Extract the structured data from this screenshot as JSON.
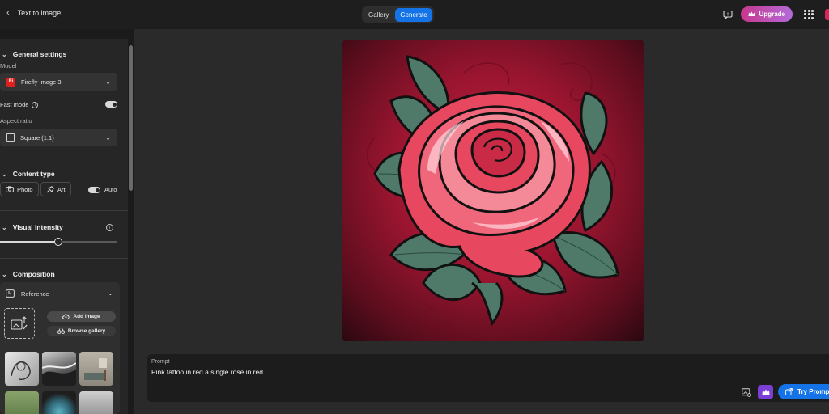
{
  "header": {
    "back_label": "Text to image",
    "tabs": [
      {
        "label": "Gallery",
        "active": false
      },
      {
        "label": "Generate",
        "active": true
      }
    ],
    "upgrade_label": "Upgrade"
  },
  "sidebar": {
    "general": {
      "title": "General settings",
      "model_label": "Model",
      "model_value": "Firefly Image 3",
      "model_icon_text": "Fi",
      "fast_mode_label": "Fast mode",
      "fast_mode_on": true,
      "aspect_label": "Aspect ratio",
      "aspect_value": "Square (1:1)"
    },
    "content_type": {
      "title": "Content type",
      "photo_label": "Photo",
      "art_label": "Art",
      "auto_label": "Auto",
      "auto_on": true
    },
    "visual_intensity": {
      "title": "Visual intensity",
      "level_fraction": 0.5
    },
    "composition": {
      "title": "Composition",
      "reference_label": "Reference",
      "add_image_label": "Add image",
      "browse_gallery_label": "Browse gallery"
    }
  },
  "prompt": {
    "label": "Prompt",
    "text": "Pink tattoo in red a single rose in red",
    "try_label": "Try Prompt"
  },
  "colors": {
    "accent": "#1473e6",
    "upgrade_gradient_start": "#c7378c",
    "upgrade_gradient_end": "#b46ad9",
    "crown_button": "#7b3fd6",
    "firefly_red": "#e0201d"
  }
}
